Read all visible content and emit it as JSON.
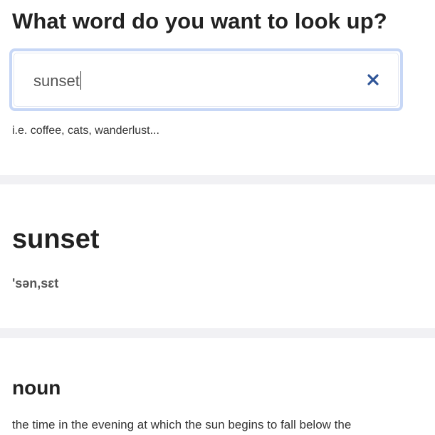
{
  "search": {
    "question": "What word do you want to look up?",
    "value": "sunset",
    "clear_icon": "close-icon",
    "hint": "i.e. coffee, cats, wanderlust..."
  },
  "result": {
    "word": "sunset",
    "phonetic": "'sən,sɛt"
  },
  "meaning": {
    "part_of_speech": "noun",
    "definition": "the time in the evening at which the sun begins to fall below the"
  },
  "colors": {
    "accent": "#2f5597",
    "focus_ring": "#c7d7f6",
    "divider": "#f1f1f4"
  }
}
